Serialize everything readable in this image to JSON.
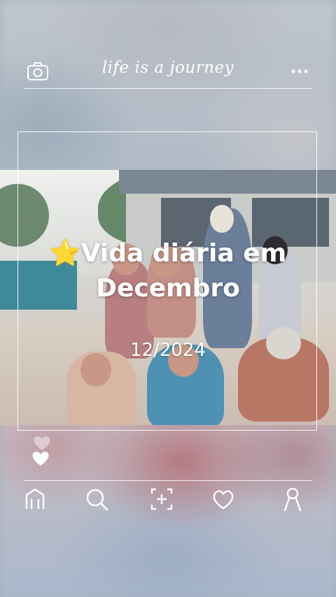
{
  "header": {
    "brand_text": "life is a journey",
    "camera_icon": "camera-icon",
    "more_icon": "more-dots-icon"
  },
  "post": {
    "emoji": "⭐",
    "title": "Vida diária em Decembro",
    "date": "12/2024"
  },
  "reactions": {
    "icon": "heart-icon"
  },
  "bottom_nav": [
    {
      "name": "home",
      "icon": "home-icon"
    },
    {
      "name": "search",
      "icon": "search-icon"
    },
    {
      "name": "add",
      "icon": "add-frame-icon"
    },
    {
      "name": "likes",
      "icon": "heart-outline-icon"
    },
    {
      "name": "profile",
      "icon": "profile-icon"
    }
  ],
  "colors": {
    "text": "#ffffff",
    "star": "#f6c23a"
  }
}
